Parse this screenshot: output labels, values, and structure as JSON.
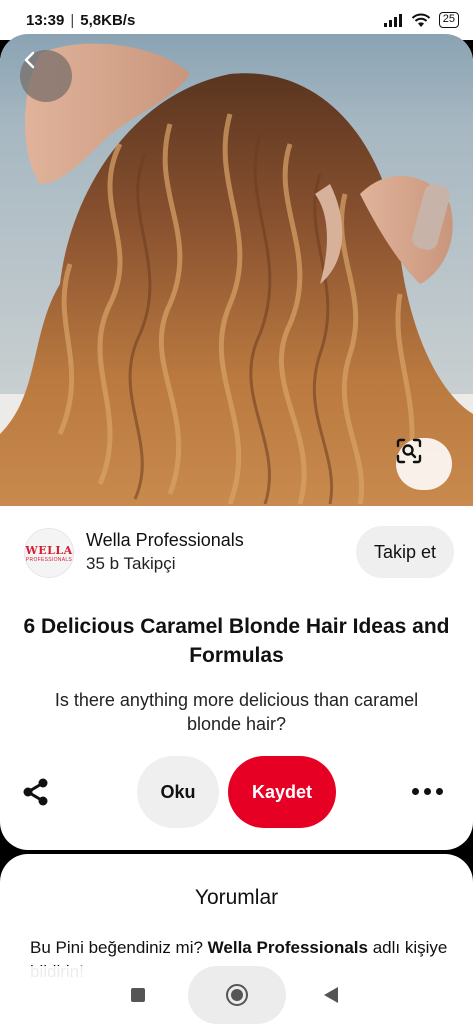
{
  "status_bar": {
    "time": "13:39",
    "separator": "|",
    "network_speed": "5,8KB/s",
    "battery": "25"
  },
  "pin": {
    "image_alt": "Woman with long wavy caramel blonde hair",
    "creator": {
      "name": "Wella Professionals",
      "followers": "35 b Takipçi",
      "avatar_text": "WELLA",
      "avatar_subtext": "PROFESSIONALS"
    },
    "follow_label": "Takip et",
    "title": "6 Delicious Caramel Blonde Hair Ideas and Formulas",
    "description": "Is there anything more delicious than caramel blonde hair?",
    "actions": {
      "read_label": "Oku",
      "save_label": "Kaydet"
    }
  },
  "comments": {
    "title": "Yorumlar",
    "prompt_prefix": "Bu Pini beğendiniz mi? ",
    "prompt_name": "Wella Professionals",
    "prompt_suffix": " adlı kişiye bildirin!"
  },
  "icons": {
    "back": "chevron-left-icon",
    "lens": "visual-search-icon",
    "share": "share-icon",
    "more": "more-dots-icon",
    "wifi": "wifi-icon",
    "signal": "signal-icon"
  },
  "colors": {
    "save_button": "#e60023",
    "brand_wella": "#d51e33"
  }
}
